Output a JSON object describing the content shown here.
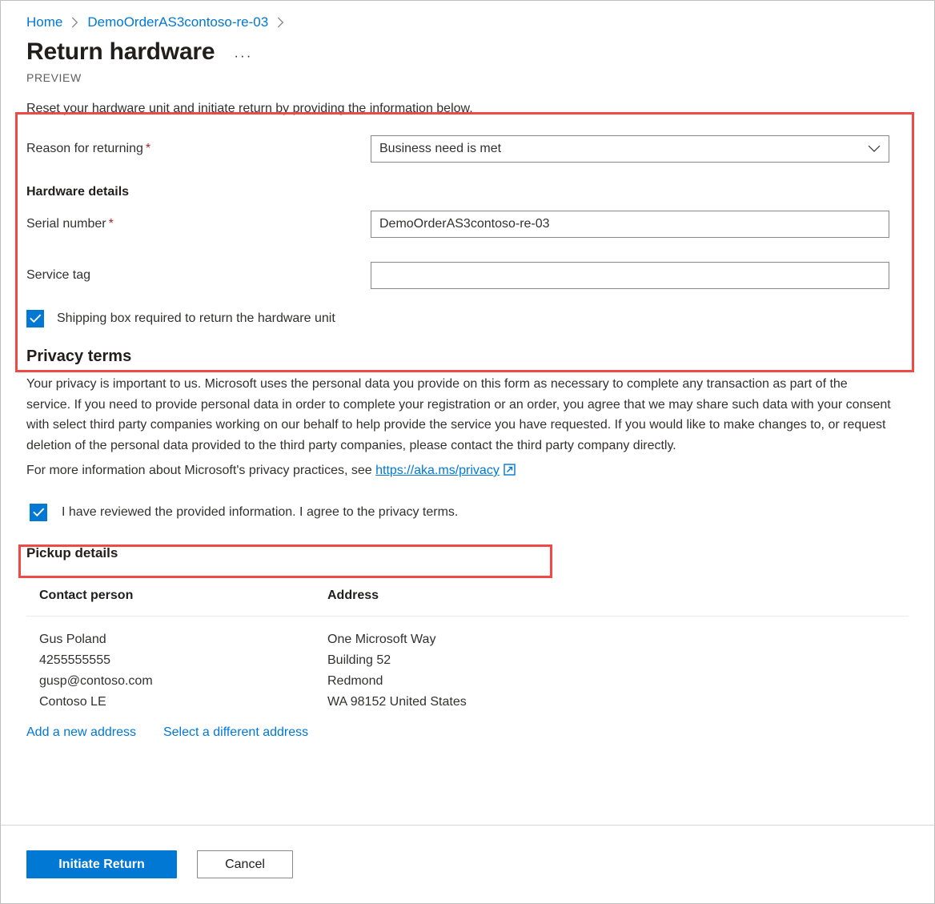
{
  "breadcrumb": {
    "items": [
      {
        "label": "Home"
      },
      {
        "label": "DemoOrderAS3contoso-re-03"
      }
    ],
    "separator_icon": "chevron-right-icon"
  },
  "header": {
    "title": "Return hardware",
    "overflow_icon": "ellipsis-icon",
    "overflow_label": "···",
    "preview_tag": "PREVIEW"
  },
  "form": {
    "intro": "Reset your hardware unit and initiate return by providing the information below.",
    "reason": {
      "label": "Reason for returning",
      "required_marker": "*",
      "selected": "Business need is met",
      "chevron_icon": "chevron-down-icon",
      "options": [
        "Business need is met"
      ]
    },
    "hardware_details_heading": "Hardware details",
    "serial_number": {
      "label": "Serial number",
      "required_marker": "*",
      "value": "DemoOrderAS3contoso-re-03",
      "placeholder": ""
    },
    "service_tag": {
      "label": "Service tag",
      "value": "",
      "placeholder": ""
    },
    "shipping_box": {
      "label": "Shipping box required to return the hardware unit",
      "checked": true,
      "check_icon": "checkmark-icon"
    }
  },
  "privacy": {
    "heading": "Privacy terms",
    "paragraph": "Your privacy is important to us. Microsoft uses the personal data you provide on this form as necessary to complete any transaction as part of the service. If you need to provide personal data in order to complete your registration or an order, you agree that we may share such data with your consent with select third party companies working on our behalf to help provide the service you have requested. If you would like to make changes to, or request deletion of the personal data provided to the third party companies, please contact the third party company directly.",
    "more_info_prefix": "For more information about Microsoft's privacy practices, see",
    "link_text": "https://aka.ms/privacy",
    "link_icon": "external-link-icon",
    "consent": {
      "label": "I have reviewed the provided information. I agree to the privacy terms.",
      "checked": true,
      "check_icon": "checkmark-icon"
    }
  },
  "pickup": {
    "heading": "Pickup details",
    "columns": [
      "Contact person",
      "Address"
    ],
    "rows": [
      {
        "contact_person": [
          "Gus Poland",
          "4255555555",
          "gusp@contoso.com",
          "Contoso LE"
        ],
        "address": [
          "One Microsoft Way",
          "Building 52",
          "Redmond",
          "WA 98152 United States"
        ]
      }
    ],
    "actions": [
      {
        "label": "Add a new address"
      },
      {
        "label": "Select a different address"
      }
    ]
  },
  "footer": {
    "primary_button": "Initiate Return",
    "secondary_button": "Cancel"
  },
  "colors": {
    "accent": "#0078d4",
    "required": "#a4262c",
    "annotation": "#f04a44",
    "text": "#323130",
    "border": "#8a8886"
  }
}
